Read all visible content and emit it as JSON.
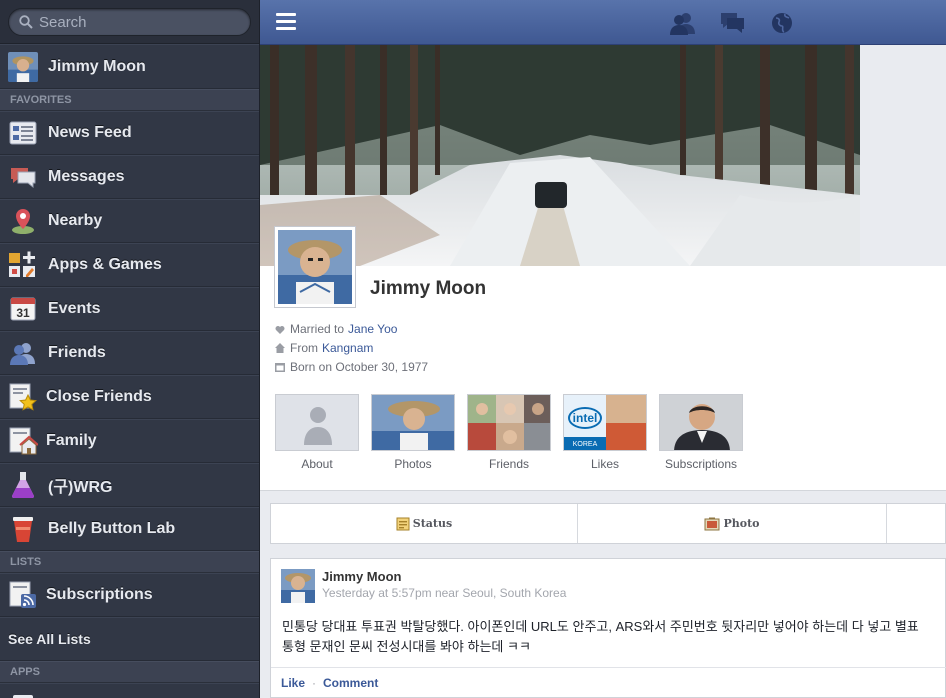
{
  "search": {
    "placeholder": "Search"
  },
  "sidebar": {
    "user": "Jimmy Moon",
    "favorites_header": "FAVORITES",
    "favorites": [
      {
        "label": "News Feed",
        "icon": "news-feed-icon"
      },
      {
        "label": "Messages",
        "icon": "messages-icon"
      },
      {
        "label": "Nearby",
        "icon": "nearby-icon"
      },
      {
        "label": "Apps & Games",
        "icon": "apps-games-icon"
      },
      {
        "label": "Events",
        "icon": "calendar-icon"
      },
      {
        "label": "Friends",
        "icon": "friends-icon"
      },
      {
        "label": "Close Friends",
        "icon": "close-friends-star-icon"
      },
      {
        "label": "Family",
        "icon": "family-house-icon"
      },
      {
        "label": "(구)WRG",
        "icon": "flask-icon"
      },
      {
        "label": "Belly Button Lab",
        "icon": "cup-icon"
      }
    ],
    "events_day": "31",
    "lists_header": "LISTS",
    "subscriptions": "Subscriptions",
    "see_all_lists": "See All Lists",
    "apps_header": "APPS"
  },
  "topbar": {
    "icons": [
      "friend-requests-icon",
      "messages-icon",
      "notifications-globe-icon"
    ]
  },
  "profile": {
    "name": "Jimmy Moon",
    "married_prefix": "Married to",
    "married_to": "Jane Yoo",
    "from_prefix": "From",
    "from": "Kangnam",
    "born": "Born on October 30, 1977",
    "tiles": [
      "About",
      "Photos",
      "Friends",
      "Likes",
      "Subscriptions"
    ],
    "likes_tile_text": {
      "brand": "intel",
      "sub": "KOREA"
    }
  },
  "composer": {
    "status": "Status",
    "photo": "Photo"
  },
  "post": {
    "author": "Jimmy Moon",
    "meta": "Yesterday at 5:57pm near Seoul, South Korea",
    "line1": "민통당 당대표 투표권 박탈당했다. 아이폰인데 URL도 안주고, ARS와서 주민번호 뒷자리만 넣어야 하는데 다 넣고 별표",
    "line2": "통형 문재인 문씨 전성시대를 봐야 하는데 ㅋㅋ",
    "like": "Like",
    "sep": "·",
    "comment": "Comment"
  },
  "colors": {
    "brand_blue": "#3b5998",
    "sidebar_bg": "#313745",
    "topbar": "#4b65a0"
  }
}
